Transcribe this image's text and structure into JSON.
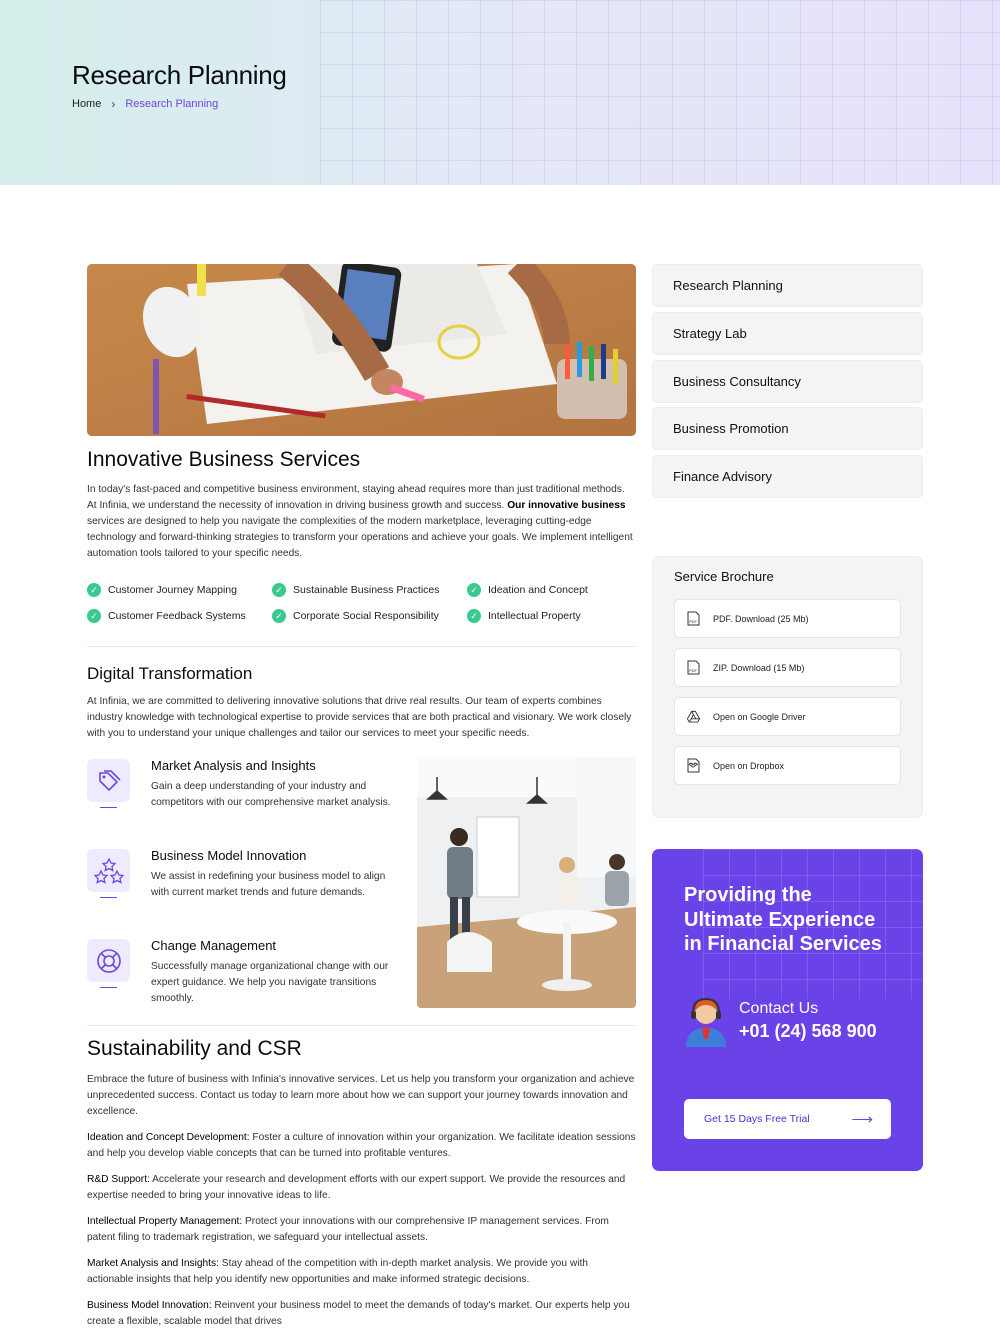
{
  "page": {
    "title": "Research Planning"
  },
  "breadcrumb": {
    "home": "Home",
    "current": "Research Planning"
  },
  "intro": {
    "heading": "Innovative Business Services",
    "text_before": "In today's fast-paced and competitive business environment, staying ahead requires more than just traditional methods. At Infinia, we understand the necessity of innovation in driving business growth and success. ",
    "text_bold": "Our innovative business",
    "text_after": " services are designed to help you navigate the complexities of the modern marketplace, leveraging cutting-edge technology and forward-thinking strategies to transform your operations and achieve your goals. We implement intelligent automation tools tailored to your specific needs.",
    "checks": [
      "Customer Journey Mapping",
      "Sustainable Business Practices",
      "Ideation and Concept",
      "Customer Feedback Systems",
      "Corporate Social Responsibility",
      "Intellectual Property"
    ]
  },
  "digital": {
    "heading": "Digital Transformation",
    "text": "At Infinia, we are committed to delivering innovative solutions that drive real results. Our team of experts combines industry knowledge with technological expertise to provide services that are both practical and visionary. We work closely with you to understand your unique challenges and tailor our services to meet your specific needs.",
    "features": [
      {
        "title": "Market Analysis and Insights",
        "text": "Gain a deep understanding of your industry and competitors with our comprehensive market analysis.",
        "icon": "tag-icon"
      },
      {
        "title": "Business Model Innovation",
        "text": "We assist in redefining your business model to align with current market trends and future demands.",
        "icon": "stars-icon"
      },
      {
        "title": "Change Management",
        "text": "Successfully manage organizational change with our expert guidance. We help you navigate transitions smoothly.",
        "icon": "lifebuoy-icon"
      }
    ]
  },
  "csr": {
    "heading": "Sustainability and CSR",
    "intro": "Embrace the future of business with Infinia's innovative services. Let us help you transform your organization and achieve unprecedented success. Contact us today to learn more about how we can support your journey towards innovation and excellence.",
    "items": [
      {
        "label": "Ideation and Concept Development:",
        "text": " Foster a culture of innovation within your organization. We facilitate ideation sessions and help you develop viable concepts that can be turned into profitable ventures."
      },
      {
        "label": "R&D Support:",
        "text": " Accelerate your research and development efforts with our expert support. We provide the resources and expertise needed to bring your innovative ideas to life."
      },
      {
        "label": "Intellectual Property Management:",
        "text": " Protect your innovations with our comprehensive IP management services. From patent filing to trademark registration, we safeguard your intellectual assets."
      },
      {
        "label": "Market Analysis and Insights:",
        "text": " Stay ahead of the competition with in-depth market analysis. We provide you with actionable insights that help you identify new opportunities and make informed strategic decisions."
      },
      {
        "label": "Business Model Innovation:",
        "text": " Reinvent your business model to meet the demands of today's market. Our experts help you create a flexible, scalable model that drives"
      }
    ]
  },
  "sidebar": {
    "services": [
      "Research Planning",
      "Strategy Lab",
      "Business Consultancy",
      "Business Promotion",
      "Finance Advisory"
    ],
    "brochure": {
      "title": "Service Brochure",
      "items": [
        {
          "label": "PDF. Download (25 Mb)",
          "icon": "pdf-file-icon"
        },
        {
          "label": "ZIP. Download (15 Mb)",
          "icon": "zip-file-icon"
        },
        {
          "label": "Open on Google Driver",
          "icon": "google-drive-icon"
        },
        {
          "label": "Open on Dropbox",
          "icon": "dropbox-icon"
        }
      ]
    },
    "cta": {
      "heading": "Providing the Ultimate Experience in Financial Services",
      "contact_label": "Contact Us",
      "phone": "+01 (24) 568 900",
      "button": "Get 15 Days Free Trial"
    }
  },
  "colors": {
    "accent": "#6b46e5",
    "check": "#3cc98f",
    "cta_bg": "#6a43e8"
  }
}
